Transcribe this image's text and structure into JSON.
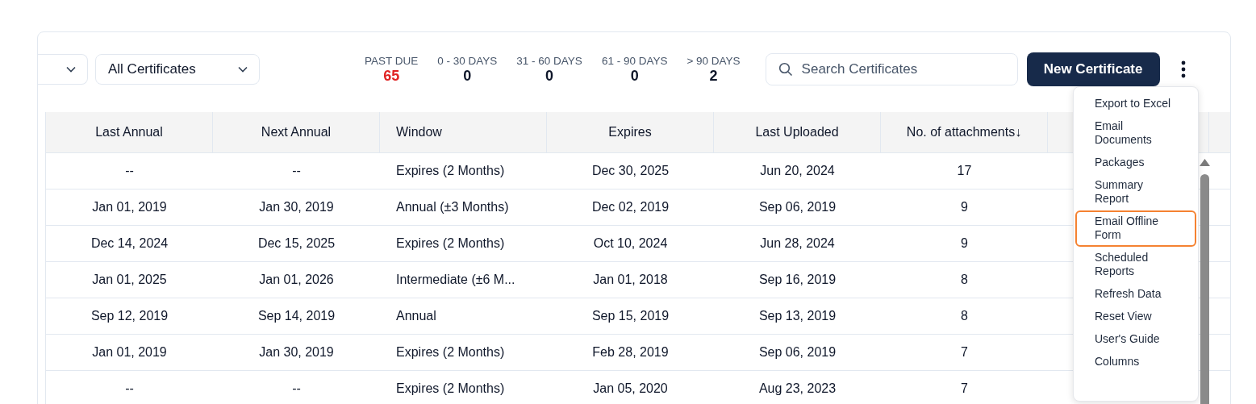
{
  "filters": [
    {
      "kind": "cut"
    },
    {
      "kind": "select",
      "value": "All Certificates"
    }
  ],
  "stats": [
    {
      "label": "PAST DUE",
      "value": "65",
      "kind": "alert"
    },
    {
      "label": "0 - 30 DAYS",
      "value": "0",
      "kind": "normal"
    },
    {
      "label": "31 - 60 DAYS",
      "value": "0",
      "kind": "normal"
    },
    {
      "label": "61 - 90 DAYS",
      "value": "0",
      "kind": "normal"
    },
    {
      "label": "> 90 DAYS",
      "value": "2",
      "kind": "normal"
    }
  ],
  "search": {
    "placeholder": "Search Certificates"
  },
  "new_button": "New Certificate",
  "table": {
    "columns": [
      "Last Annual",
      "Next Annual",
      "Window",
      "Expires",
      "Last Uploaded",
      "No. of attachments↓"
    ],
    "rows": [
      [
        "--",
        "--",
        "Expires (2 Months)",
        "Dec 30, 2025",
        "Jun 20, 2024",
        "17"
      ],
      [
        "Jan 01, 2019",
        "Jan 30, 2019",
        "Annual (±3 Months)",
        "Dec 02, 2019",
        "Sep 06, 2019",
        "9"
      ],
      [
        "Dec 14, 2024",
        "Dec 15, 2025",
        "Expires (2 Months)",
        "Oct 10, 2024",
        "Jun 28, 2024",
        "9"
      ],
      [
        "Jan 01, 2025",
        "Jan 01, 2026",
        "Intermediate (±6 M...",
        "Jan 01, 2018",
        "Sep 16, 2019",
        "8"
      ],
      [
        "Sep 12, 2019",
        "Sep 14, 2019",
        "Annual",
        "Sep 15, 2019",
        "Sep 13, 2019",
        "8"
      ],
      [
        "Jan 01, 2019",
        "Jan 30, 2019",
        "Expires (2 Months)",
        "Feb 28, 2019",
        "Sep 06, 2019",
        "7"
      ],
      [
        "--",
        "--",
        "Expires (2 Months)",
        "Jan 05, 2020",
        "Aug 23, 2023",
        "7"
      ]
    ]
  },
  "menu": {
    "items": [
      {
        "label": "Export to Excel",
        "highlighted": false
      },
      {
        "label": "Email Documents",
        "highlighted": false
      },
      {
        "label": "Packages",
        "highlighted": false
      },
      {
        "label": "Summary Report",
        "highlighted": false
      },
      {
        "label": "Email Offline Form",
        "highlighted": true
      },
      {
        "label": "Scheduled Reports",
        "highlighted": false
      },
      {
        "label": "Refresh Data",
        "highlighted": false
      },
      {
        "label": "Reset View",
        "highlighted": false
      },
      {
        "label": "User's Guide",
        "highlighted": false
      },
      {
        "label": "Columns",
        "highlighted": false
      }
    ]
  }
}
